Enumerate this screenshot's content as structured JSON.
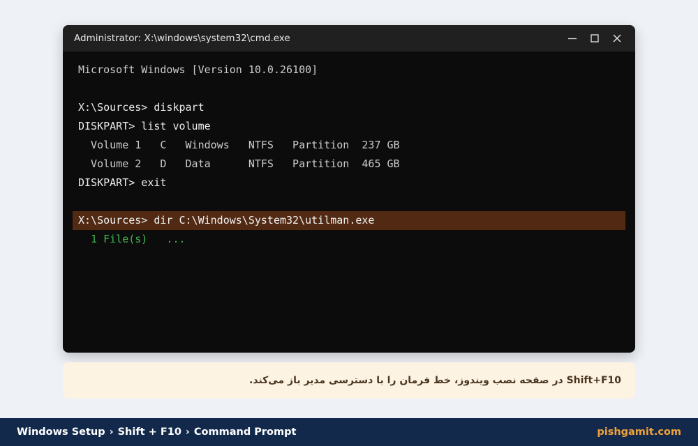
{
  "window": {
    "title": "Administrator: X:\\windows\\system32\\cmd.exe",
    "controls": [
      "minimize-icon",
      "maximize-icon",
      "close-icon"
    ]
  },
  "terminal": {
    "lines": [
      "Microsoft Windows [Version 10.0.26100]",
      "",
      "X:\\Sources> diskpart",
      "DISKPART> list volume",
      "  Volume 1   C   Windows   NTFS   Partition  237 GB",
      "  Volume 2   D   Data      NTFS   Partition  465 GB",
      "DISKPART> exit",
      "",
      "X:\\Sources> dir C:\\Windows\\System32\\utilman.exe",
      "  1 File(s)   ..."
    ]
  },
  "caption": {
    "text": "Shift+F10 در صفحه نصب ویندوز، خط فرمان را با دسترسی مدیر باز می‌کند."
  },
  "footer": {
    "crumbs": [
      "Windows Setup",
      "Shift + F10",
      "Command Prompt"
    ],
    "separator": "›",
    "brand": "pishgamit.com"
  },
  "colors": {
    "terminal_bg": "#0c0c0c",
    "highlight_bg": "#522a13",
    "success_text": "#3fb950",
    "footer_bg": "#13294b",
    "brand": "#f0a23a",
    "caption_bg": "#fdf3e3"
  }
}
